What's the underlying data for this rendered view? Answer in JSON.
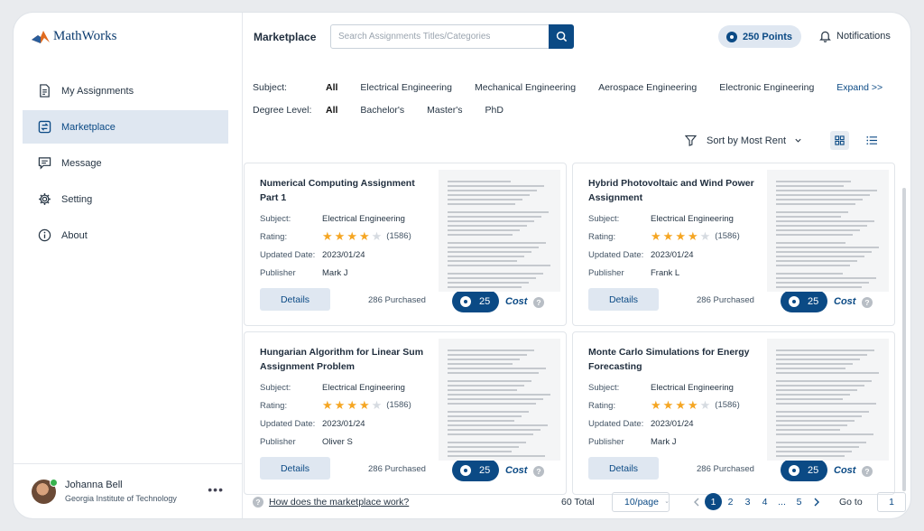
{
  "app": {
    "logo_text": "MathWorks"
  },
  "sidebar": {
    "items": [
      {
        "label": "My Assignments",
        "icon": "document-icon"
      },
      {
        "label": "Marketplace",
        "icon": "marketplace-icon",
        "active": true
      },
      {
        "label": "Message",
        "icon": "message-icon"
      },
      {
        "label": "Setting",
        "icon": "gear-icon"
      },
      {
        "label": "About",
        "icon": "info-icon"
      }
    ]
  },
  "user": {
    "name": "Johanna Bell",
    "org": "Georgia Institute of Technology",
    "more": "•••"
  },
  "header": {
    "title": "Marketplace",
    "search_placeholder": "Search Assignments Titles/Categories",
    "points": "250 Points",
    "notifications": "Notifications"
  },
  "filters": {
    "subject_label": "Subject:",
    "subjects": [
      "All",
      "Electrical Engineering",
      "Mechanical Engineering",
      "Aerospace Engineering",
      "Electronic Engineering"
    ],
    "expand": "Expand >>",
    "degree_label": "Degree Level:",
    "degrees": [
      "All",
      "Bachelor's",
      "Master's",
      "PhD"
    ],
    "sort": "Sort by Most Rent"
  },
  "cards": [
    {
      "title": "Numerical Computing Assignment Part 1",
      "subject": "Electrical Engineering",
      "rating": 4,
      "reviews": "(1586)",
      "date": "2023/01/24",
      "publisher": "Mark J",
      "purchased": "286 Purchased",
      "cost": "25"
    },
    {
      "title": "Hybrid Photovoltaic and Wind Power Assignment",
      "subject": "Electrical Engineering",
      "rating": 4,
      "reviews": "(1586)",
      "date": "2023/01/24",
      "publisher": "Frank L",
      "purchased": "286 Purchased",
      "cost": "25"
    },
    {
      "title": "Hungarian Algorithm for Linear Sum Assignment Problem",
      "subject": "Electrical Engineering",
      "rating": 4,
      "reviews": "(1586)",
      "date": "2023/01/24",
      "publisher": "Oliver S",
      "purchased": "286 Purchased",
      "cost": "25"
    },
    {
      "title": "Monte Carlo Simulations for Energy Forecasting",
      "subject": "Electrical Engineering",
      "rating": 4,
      "reviews": "(1586)",
      "date": "2023/01/24",
      "publisher": "Mark J",
      "purchased": "286 Purchased",
      "cost": "25"
    }
  ],
  "card_labels": {
    "subject": "Subject:",
    "rating": "Rating:",
    "date": "Updated Date:",
    "publisher": "Publisher",
    "details": "Details",
    "cost": "Cost",
    "help": "?"
  },
  "footer": {
    "how": "How does the marketplace work?",
    "total": "60 Total",
    "per_page": "10/page",
    "pages": [
      "1",
      "2",
      "3",
      "4",
      "...",
      "5"
    ],
    "current_page": "1",
    "goto_label": "Go to",
    "goto_value": "1"
  },
  "colors": {
    "brand": "#0b4a85",
    "star": "#f5a623",
    "active_bg": "#dfe7f1"
  }
}
